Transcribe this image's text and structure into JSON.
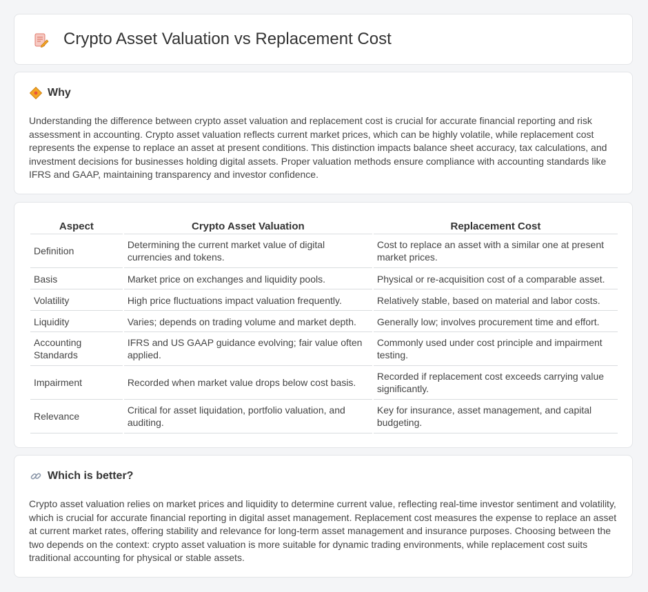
{
  "header": {
    "title": "Crypto Asset Valuation vs Replacement Cost",
    "icon": "document-pencil-icon"
  },
  "why": {
    "heading": "Why",
    "icon": "diamond-sign-icon",
    "text": "Understanding the difference between crypto asset valuation and replacement cost is crucial for accurate financial reporting and risk assessment in accounting. Crypto asset valuation reflects current market prices, which can be highly volatile, while replacement cost represents the expense to replace an asset at present conditions. This distinction impacts balance sheet accuracy, tax calculations, and investment decisions for businesses holding digital assets. Proper valuation methods ensure compliance with accounting standards like IFRS and GAAP, maintaining transparency and investor confidence."
  },
  "comparison": {
    "headers": [
      "Aspect",
      "Crypto Asset Valuation",
      "Replacement Cost"
    ],
    "rows": [
      [
        "Definition",
        "Determining the current market value of digital currencies and tokens.",
        "Cost to replace an asset with a similar one at present market prices."
      ],
      [
        "Basis",
        "Market price on exchanges and liquidity pools.",
        "Physical or re-acquisition cost of a comparable asset."
      ],
      [
        "Volatility",
        "High price fluctuations impact valuation frequently.",
        "Relatively stable, based on material and labor costs."
      ],
      [
        "Liquidity",
        "Varies; depends on trading volume and market depth.",
        "Generally low; involves procurement time and effort."
      ],
      [
        "Accounting Standards",
        "IFRS and US GAAP guidance evolving; fair value often applied.",
        "Commonly used under cost principle and impairment testing."
      ],
      [
        "Impairment",
        "Recorded when market value drops below cost basis.",
        "Recorded if replacement cost exceeds carrying value significantly."
      ],
      [
        "Relevance",
        "Critical for asset liquidation, portfolio valuation, and auditing.",
        "Key for insurance, asset management, and capital budgeting."
      ]
    ]
  },
  "better": {
    "heading": "Which is better?",
    "icon": "link-icon",
    "text": "Crypto asset valuation relies on market prices and liquidity to determine current value, reflecting real-time investor sentiment and volatility, which is crucial for accurate financial reporting in digital asset management. Replacement cost measures the expense to replace an asset at current market rates, offering stability and relevance for long-term asset management and insurance purposes. Choosing between the two depends on the context: crypto asset valuation is more suitable for dynamic trading environments, while replacement cost suits traditional accounting for physical or stable assets."
  }
}
